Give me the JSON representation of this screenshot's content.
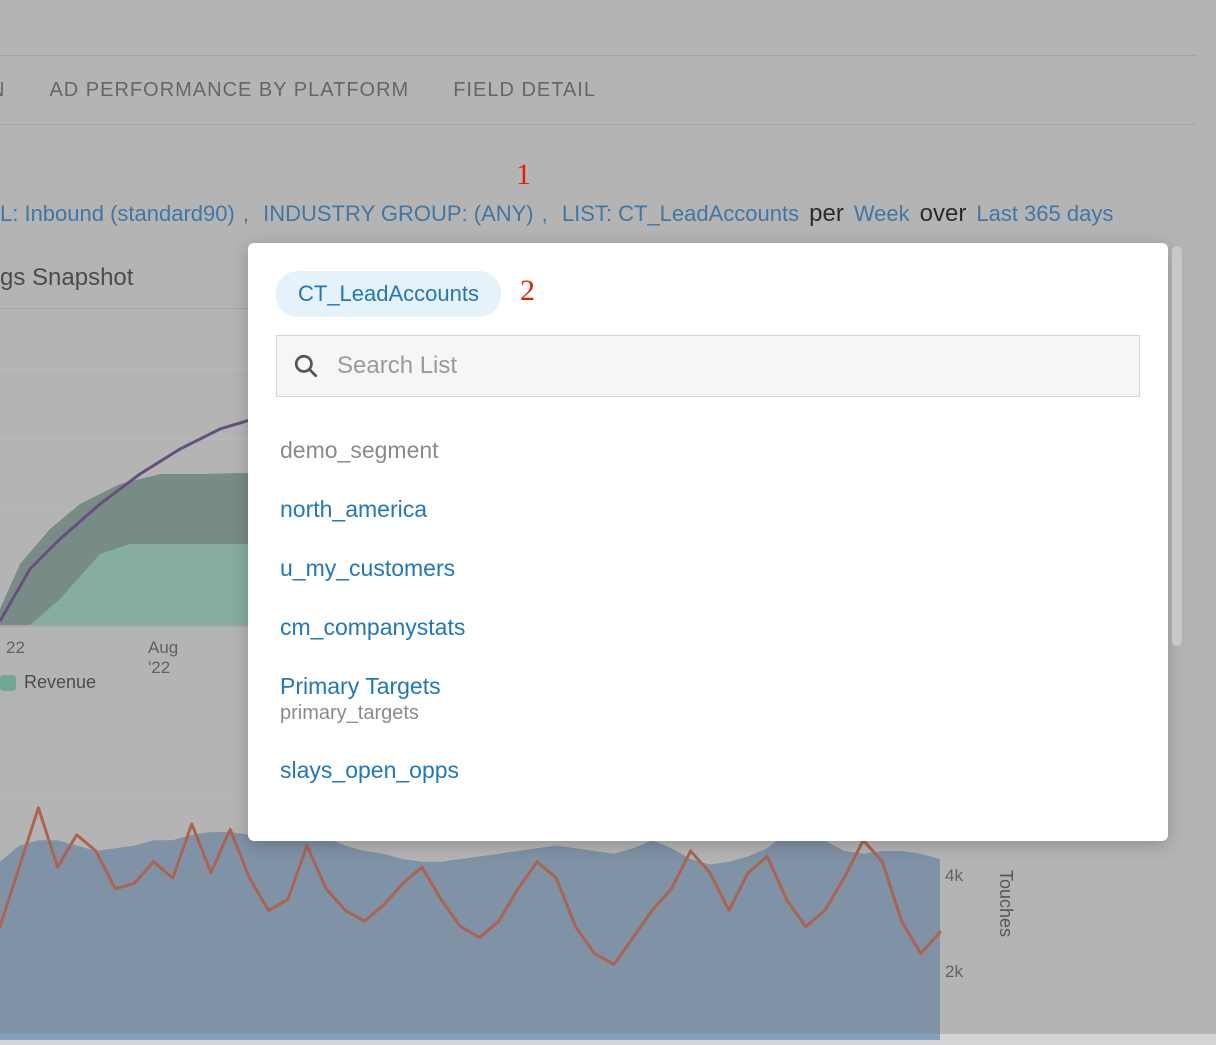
{
  "nav": {
    "items": [
      {
        "label": "N"
      },
      {
        "label": "AD PERFORMANCE BY PLATFORM"
      },
      {
        "label": "FIELD DETAIL"
      }
    ]
  },
  "filters": {
    "segment_0": "L: Inbound (standard90)",
    "segment_1": "INDUSTRY GROUP: (ANY)",
    "segment_2": "LIST: CT_LeadAccounts",
    "per": "per",
    "per_value": "Week",
    "over": "over",
    "over_value": "Last 365 days"
  },
  "annotations": {
    "a1": "1",
    "a2": "2"
  },
  "snapshot_title": "gs Snapshot",
  "chart1": {
    "x_tick_0": "22",
    "x_tick_1": "Aug '22",
    "legend_revenue": "Revenue",
    "legend_revenue_color": "#6fbfa6"
  },
  "chart2": {
    "y_tick_4k": "4k",
    "y_tick_2k": "2k",
    "y_label": "Touches"
  },
  "dropdown": {
    "selected_chip": "CT_LeadAccounts",
    "search_placeholder": "Search List",
    "items": [
      {
        "primary": "demo_segment",
        "secondary": "",
        "muted": true
      },
      {
        "primary": "north_america",
        "secondary": "",
        "muted": false
      },
      {
        "primary": "u_my_customers",
        "secondary": "",
        "muted": false
      },
      {
        "primary": "cm_companystats",
        "secondary": "",
        "muted": false
      },
      {
        "primary": "Primary Targets",
        "secondary": "primary_targets",
        "muted": false
      },
      {
        "primary": "slays_open_opps",
        "secondary": "",
        "muted": false
      }
    ]
  },
  "chart_data": [
    {
      "type": "line+area",
      "title": "gs Snapshot",
      "x_tick_labels": [
        "22",
        "Aug '22"
      ],
      "series": [
        {
          "name": "line_purple",
          "kind": "line",
          "y_norm": [
            0.0,
            0.12,
            0.18,
            0.24,
            0.3,
            0.35,
            0.4,
            0.44,
            0.47,
            0.5,
            0.52,
            0.54,
            0.55,
            0.55,
            0.55
          ]
        },
        {
          "name": "area_teal_dark",
          "kind": "area",
          "y_norm": [
            0.0,
            0.08,
            0.18,
            0.24,
            0.3,
            0.34,
            0.36,
            0.36,
            0.37,
            0.37,
            0.38,
            0.38,
            0.38,
            0.38,
            0.38
          ]
        },
        {
          "name": "area_teal_light_Revenue",
          "kind": "area",
          "y_norm": [
            0.0,
            0.0,
            0.07,
            0.16,
            0.18,
            0.18,
            0.18,
            0.18,
            0.18,
            0.18,
            0.18,
            0.18,
            0.18,
            0.18,
            0.18
          ]
        }
      ]
    },
    {
      "type": "line+area",
      "ylabel": "Touches",
      "ylim": [
        0,
        5000
      ],
      "series": [
        {
          "name": "area_blue",
          "kind": "area",
          "values": [
            3300,
            3600,
            3700,
            3700,
            3600,
            3500,
            3550,
            3600,
            3700,
            3700,
            3800,
            3850,
            3850,
            3800,
            3750,
            3700,
            3700,
            3750,
            3600,
            3500,
            3450,
            3350,
            3300,
            3300,
            3350,
            3400,
            3450,
            3500,
            3550,
            3600,
            3550,
            3500,
            3450,
            3550,
            3700,
            3550,
            3350,
            3250,
            3300,
            3400,
            3550,
            3850,
            3900,
            3700,
            3500,
            3450,
            3500,
            3500,
            3450,
            3350
          ]
        },
        {
          "name": "line_orange",
          "kind": "line",
          "values": [
            2100,
            3200,
            4300,
            3200,
            3800,
            3500,
            2800,
            2900,
            3300,
            3000,
            4000,
            3100,
            3900,
            3000,
            2400,
            2600,
            3600,
            2800,
            2400,
            2200,
            2500,
            2900,
            3200,
            2600,
            2100,
            1900,
            2200,
            2800,
            3300,
            3000,
            2100,
            1600,
            1400,
            1900,
            2400,
            2800,
            3500,
            3100,
            2400,
            3100,
            3400,
            2600,
            2100,
            2400,
            3000,
            3700,
            3300,
            2200,
            1600,
            2000
          ]
        }
      ]
    }
  ]
}
